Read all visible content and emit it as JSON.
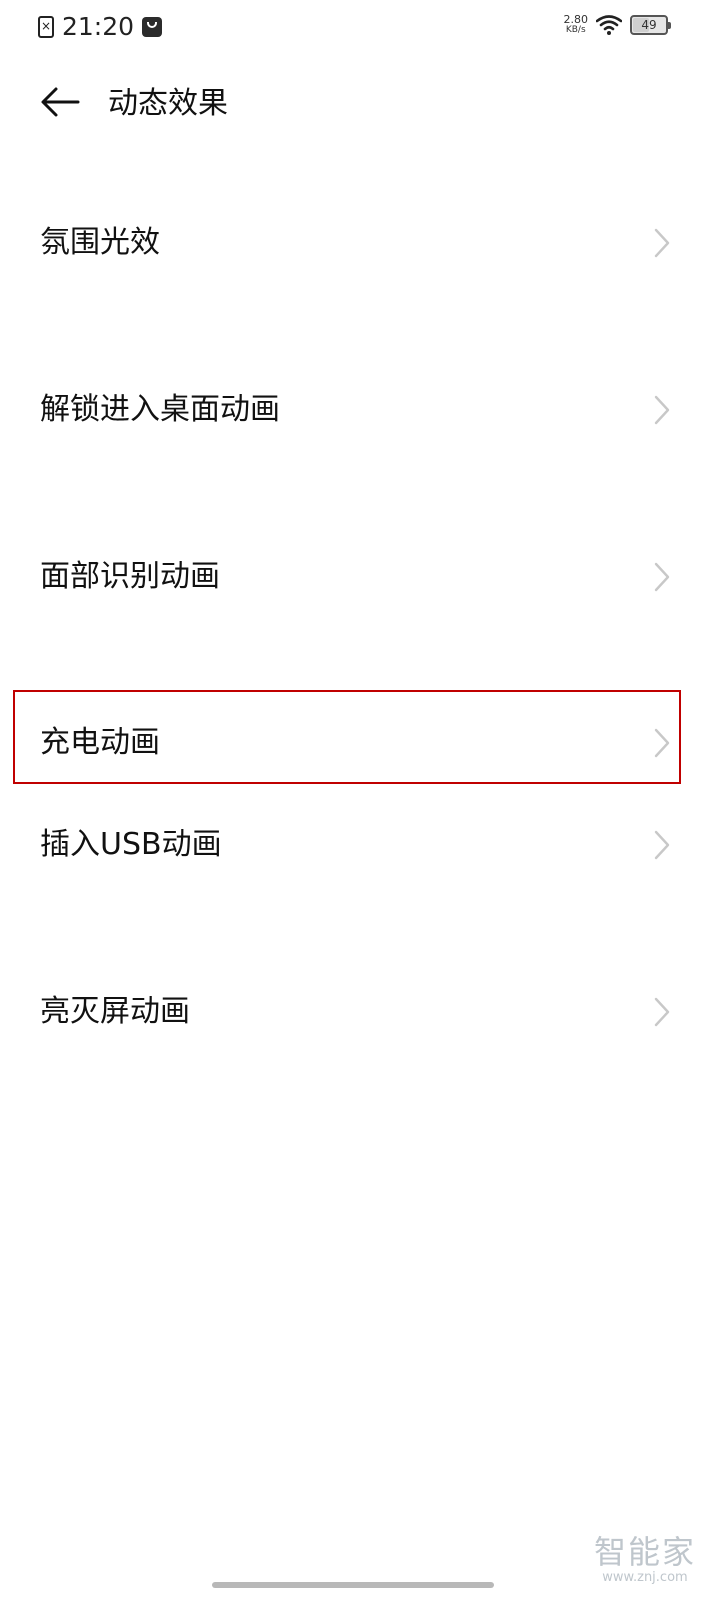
{
  "status_bar": {
    "time": "21:20",
    "net_speed_value": "2.80",
    "net_speed_unit": "KB/s",
    "battery_level": "49",
    "battery_fraction": 0.49
  },
  "header": {
    "title": "动态效果",
    "back_icon": "back-arrow-icon"
  },
  "items": [
    {
      "label": "氛围光效"
    },
    {
      "label": "解锁进入桌面动画"
    },
    {
      "label": "面部识别动画"
    },
    {
      "label": "充电动画"
    },
    {
      "label": "插入USB动画"
    },
    {
      "label": "亮灭屏动画"
    }
  ],
  "watermark": {
    "title": "智能家",
    "url": "www.znj.com"
  },
  "colors": {
    "highlight": "#c00000",
    "chevron": "#c8c8c8",
    "text": "#111111"
  }
}
